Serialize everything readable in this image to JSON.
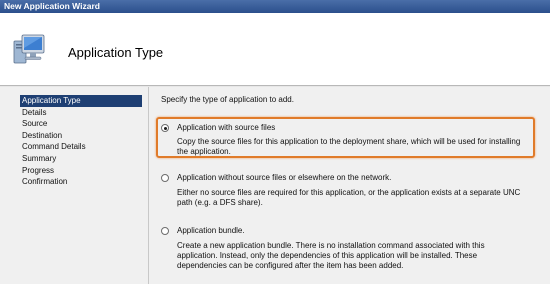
{
  "window": {
    "title": "New Application Wizard"
  },
  "header": {
    "title": "Application Type",
    "icon": "computer-monitor-icon"
  },
  "nav": {
    "items": [
      {
        "label": "Application Type",
        "active": true
      },
      {
        "label": "Details",
        "active": false
      },
      {
        "label": "Source",
        "active": false
      },
      {
        "label": "Destination",
        "active": false
      },
      {
        "label": "Command Details",
        "active": false
      },
      {
        "label": "Summary",
        "active": false
      },
      {
        "label": "Progress",
        "active": false
      },
      {
        "label": "Confirmation",
        "active": false
      }
    ]
  },
  "content": {
    "prompt": "Specify the type of application to add.",
    "options": [
      {
        "label": "Application with source files",
        "description": "Copy the source files for this application to the deployment share, which will be used for installing the application.",
        "selected": true
      },
      {
        "label": "Application without source files or elsewhere on the network.",
        "description": "Either no source files are required for this application, or the application exists at a separate UNC path (e.g. a DFS share).",
        "selected": false
      },
      {
        "label": "Application bundle.",
        "description": "Create a new application bundle.  There is no installation command associated with this application.  Instead, only the dependencies of this application will be installed.  These dependencies can be configured after the item has been added.",
        "selected": false
      }
    ]
  },
  "colors": {
    "highlight": "#e07b2a",
    "nav_active": "#1e3f73",
    "titlebar": "#2b4f8c"
  }
}
